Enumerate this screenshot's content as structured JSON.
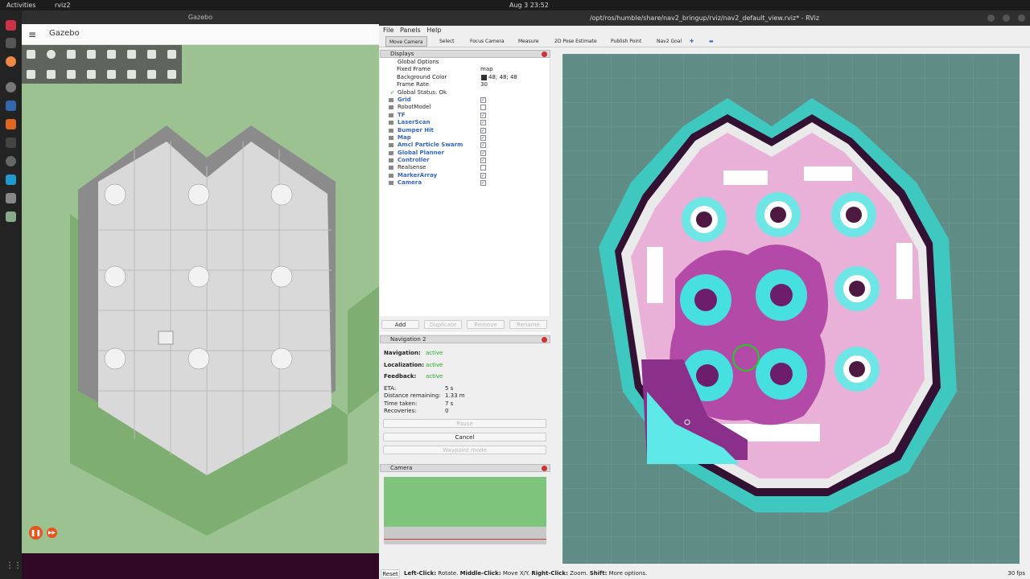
{
  "topbar": {
    "activities": "Activities",
    "app": "rviz2",
    "clock": "Aug 3  23:52"
  },
  "gazebo": {
    "window_title": "Gazebo",
    "app_name": "Gazebo"
  },
  "rviz": {
    "window_title": "/opt/ros/humble/share/nav2_bringup/rviz/nav2_default_view.rviz* - RViz",
    "menu": [
      "File",
      "Panels",
      "Help"
    ],
    "tools": [
      "Move Camera",
      "Select",
      "Focus Camera",
      "Measure",
      "2D Pose Estimate",
      "Publish Point",
      "Nav2 Goal"
    ],
    "displays": {
      "title": "Displays",
      "global_options": "Global Options",
      "fixed_frame_label": "Fixed Frame",
      "fixed_frame": "map",
      "bg_label": "Background Color",
      "bg": "48; 48; 48",
      "frame_rate_label": "Frame Rate",
      "frame_rate": "30",
      "global_status": "Global Status: Ok",
      "items": [
        "Grid",
        "RobotModel",
        "TF",
        "LaserScan",
        "Bumper Hit",
        "Map",
        "Amcl Particle Swarm",
        "Global Planner",
        "Controller",
        "Realsense",
        "MarkerArray",
        "Camera"
      ],
      "checked": [
        true,
        false,
        true,
        true,
        true,
        true,
        true,
        true,
        true,
        false,
        true,
        true
      ],
      "buttons": [
        "Add",
        "Duplicate",
        "Remove",
        "Rename"
      ]
    },
    "nav2": {
      "title": "Navigation 2",
      "navigation_label": "Navigation:",
      "navigation": "active",
      "localization_label": "Localization:",
      "localization": "active",
      "feedback_label": "Feedback:",
      "feedback": "active",
      "eta_label": "ETA:",
      "eta": "5 s",
      "distance_label": "Distance remaining:",
      "distance": "1.33 m",
      "time_label": "Time taken:",
      "time": "7 s",
      "recoveries_label": "Recoveries:",
      "recoveries": "0",
      "pause": "Pause",
      "cancel": "Cancel",
      "waypoint": "Waypoint mode"
    },
    "camera": {
      "title": "Camera"
    },
    "status": {
      "reset": "Reset",
      "hint_b1": "Left-Click:",
      "hint_t1": " Rotate. ",
      "hint_b2": "Middle-Click:",
      "hint_t2": " Move X/Y. ",
      "hint_b3": "Right-Click:",
      "hint_t3": " Zoom. ",
      "hint_b4": "Shift:",
      "hint_t4": " More options.",
      "fps": "30 fps"
    }
  }
}
